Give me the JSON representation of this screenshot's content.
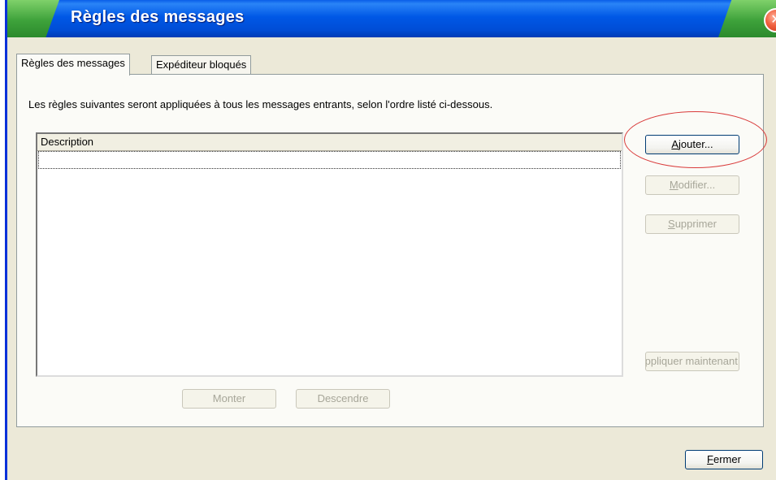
{
  "window": {
    "title": "Règles des messages",
    "close_glyph": "✕"
  },
  "tabs": [
    {
      "label": "Règles des messages",
      "active": true
    },
    {
      "label": "Expéditeur bloqués",
      "active": false
    }
  ],
  "panel": {
    "description": "Les règles suivantes seront appliquées à tous les messages entrants, selon l'ordre listé ci-dessous."
  },
  "list": {
    "column_header": "Description",
    "rows": []
  },
  "buttons": {
    "add": {
      "pre": "",
      "accel": "A",
      "post": "jouter...",
      "enabled": true
    },
    "modify": {
      "pre": "",
      "accel": "M",
      "post": "odifier...",
      "enabled": false
    },
    "delete": {
      "pre": "",
      "accel": "S",
      "post": "upprimer",
      "enabled": false
    },
    "apply": {
      "label": "Appliquer maintenant",
      "enabled": false
    },
    "up": {
      "label": "Monter",
      "enabled": false
    },
    "down": {
      "label": "Descendre",
      "enabled": false
    },
    "close": {
      "pre": "",
      "accel": "F",
      "post": "ermer",
      "enabled": true
    }
  },
  "colors": {
    "titlebar": "#0058e6",
    "annotation": "#d93a3a",
    "disabled_text": "#a7a699"
  }
}
